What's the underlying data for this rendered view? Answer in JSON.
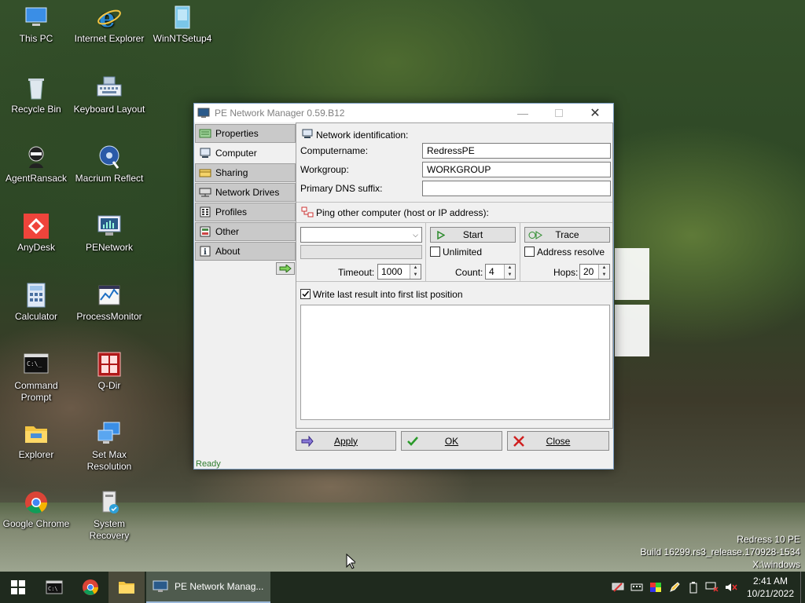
{
  "desktop": {
    "icons": [
      {
        "label": "This PC"
      },
      {
        "label": "Internet Explorer"
      },
      {
        "label": "WinNTSetup4"
      },
      {
        "label": "Recycle Bin"
      },
      {
        "label": "Keyboard Layout"
      },
      {
        "label": "AgentRansack"
      },
      {
        "label": "Macrium Reflect"
      },
      {
        "label": "AnyDesk"
      },
      {
        "label": "PENetwork"
      },
      {
        "label": "Calculator"
      },
      {
        "label": "ProcessMonitor"
      },
      {
        "label": "Command Prompt"
      },
      {
        "label": "Q-Dir"
      },
      {
        "label": "Explorer"
      },
      {
        "label": "Set Max Resolution"
      },
      {
        "label": "Google Chrome"
      },
      {
        "label": "System Recovery"
      }
    ],
    "watermark": {
      "line1": "Redress 10 PE",
      "line2": "Build 16299.rs3_release.170928-1534",
      "line3": "X:\\windows"
    }
  },
  "window": {
    "title": "PE Network Manager 0.59.B12",
    "nav": [
      {
        "label": "Properties"
      },
      {
        "label": "Computer"
      },
      {
        "label": "Sharing"
      },
      {
        "label": "Network Drives"
      },
      {
        "label": "Profiles"
      },
      {
        "label": "Other"
      },
      {
        "label": "About"
      }
    ],
    "identification": {
      "header": "Network identification:",
      "computername_label": "Computername:",
      "computername_value": "RedressPE",
      "workgroup_label": "Workgroup:",
      "workgroup_value": "WORKGROUP",
      "dns_label": "Primary DNS suffix:",
      "dns_value": ""
    },
    "ping": {
      "header": "Ping other computer (host or IP address):",
      "host_value": "",
      "start_label": "Start",
      "trace_label": "Trace",
      "unlimited_label": "Unlimited",
      "address_resolve_label": "Address resolve",
      "timeout_label": "Timeout:",
      "timeout_value": "1000",
      "count_label": "Count:",
      "count_value": "4",
      "hops_label": "Hops:",
      "hops_value": "20",
      "write_last_label": "Write last result into first list position"
    },
    "buttons": {
      "apply": "Apply",
      "ok": "OK",
      "close": "Close"
    },
    "status": "Ready"
  },
  "taskbar": {
    "task_label": "PE Network Manag...",
    "time": "2:41 AM",
    "date": "10/21/2022"
  }
}
